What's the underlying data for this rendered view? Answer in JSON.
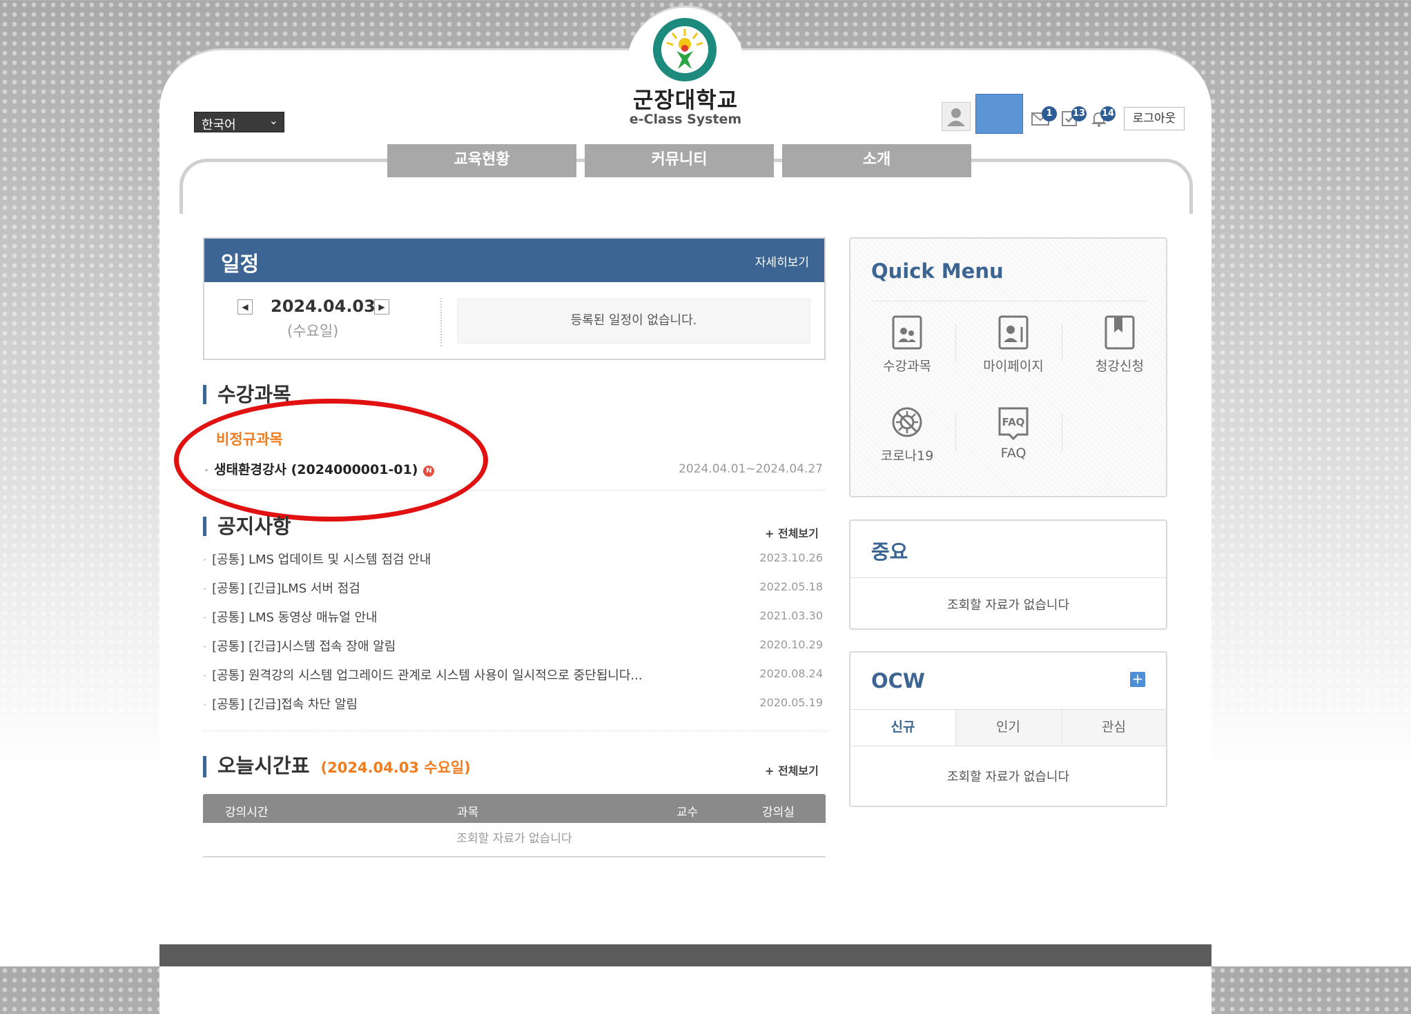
{
  "brand": {
    "name": "군장대학교",
    "subtitle": "e-Class System",
    "accent": "#3c6593",
    "highlight": "#f07c1e"
  },
  "header": {
    "language": "한국어",
    "badges": {
      "mail": "1",
      "tasks": "13",
      "alarm": "14"
    },
    "logout_label": "로그아웃"
  },
  "nav": {
    "tabs": [
      "교육현황",
      "커뮤니티",
      "소개"
    ]
  },
  "schedule": {
    "title": "일정",
    "more_label": "자세히보기",
    "date": "2024.04.03",
    "weekday": "(수요일)",
    "empty": "등록된 일정이 없습니다."
  },
  "courses": {
    "title": "수강과목",
    "category": "비정규과목",
    "items": [
      {
        "name": "생태환경강사 (2024000001-01)",
        "badge": "N",
        "period": "2024.04.01~2024.04.27"
      }
    ]
  },
  "notices": {
    "title": "공지사항",
    "more_label": "+ 전체보기",
    "items": [
      {
        "title": "[공통] LMS 업데이트 및 시스템 점검 안내",
        "date": "2023.10.26"
      },
      {
        "title": "[공통] [긴급]LMS 서버 점검",
        "date": "2022.05.18"
      },
      {
        "title": "[공통] LMS 동영상 매뉴얼 안내",
        "date": "2021.03.30"
      },
      {
        "title": "[공통] [긴급]시스템 접속 장애 알림",
        "date": "2020.10.29"
      },
      {
        "title": "[공통] 원격강의 시스템 업그레이드 관계로 시스템 사용이 일시적으로 중단됩니다...",
        "date": "2020.08.24"
      },
      {
        "title": "[공통] [긴급]접속 차단 알림",
        "date": "2020.05.19"
      }
    ]
  },
  "timetable": {
    "title": "오늘시간표",
    "date_label": "(2024.04.03 수요일)",
    "more_label": "+ 전체보기",
    "columns": [
      "강의시간",
      "과목",
      "교수",
      "강의실"
    ],
    "empty": "조회할 자료가 없습니다"
  },
  "quick_menu": {
    "title": "Quick Menu",
    "items": [
      {
        "label": "수강과목",
        "icon": "book-people-icon"
      },
      {
        "label": "마이페이지",
        "icon": "profile-book-icon"
      },
      {
        "label": "청강신청",
        "icon": "bookmark-book-icon"
      },
      {
        "label": "코로나19",
        "icon": "virus-icon"
      },
      {
        "label": "FAQ",
        "icon": "faq-icon",
        "icon_text": "FAQ"
      }
    ]
  },
  "important": {
    "title": "중요",
    "empty": "조회할 자료가 없습니다"
  },
  "ocw": {
    "title": "OCW",
    "plus": "+",
    "tabs": [
      "신규",
      "인기",
      "관심"
    ],
    "empty": "조회할 자료가 없습니다"
  }
}
